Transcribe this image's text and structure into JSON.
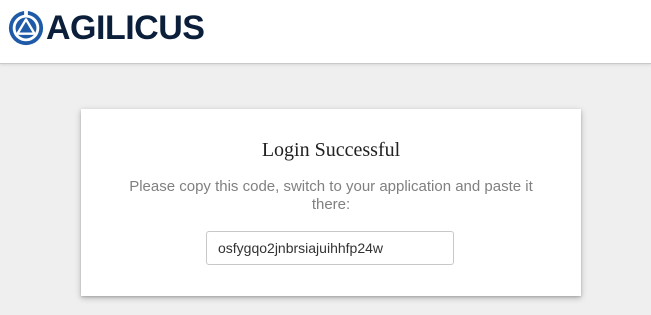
{
  "header": {
    "brand_name": "AGILICUS",
    "logo_icon": "agilicus-logo-icon",
    "brand_color": "#1e5aa8"
  },
  "card": {
    "title": "Login Successful",
    "message": "Please copy this code, switch to your application and paste it there:",
    "code_value": "osfygqo2jnbrsiajuihhfp24w"
  }
}
